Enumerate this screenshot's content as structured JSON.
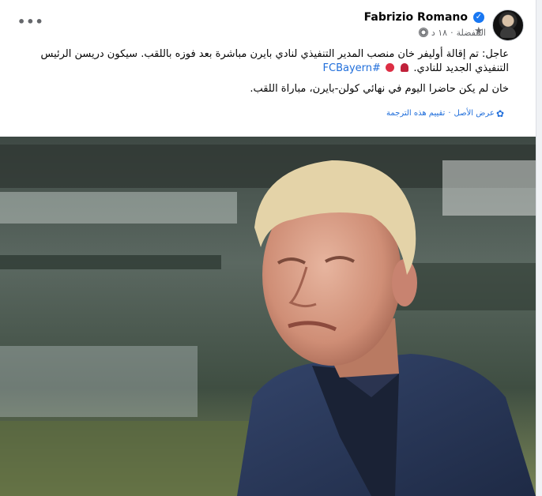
{
  "post": {
    "author": "Fabrizio Romano",
    "verified_mark": "✓",
    "favorites_label": "المفضلة",
    "time": "١٨ د",
    "separator": "·",
    "more_label": "•••",
    "paragraph1": "عاجل: تم إقالة أوليفر خان منصب المدير التنفيذي لنادي بايرن مباشرة بعد فوزه باللقب. سيكون دريسن الرئيس التنفيذي الجديد للنادي.",
    "hashtag": "#FCBayern",
    "paragraph2": "خان لم يكن حاضرا اليوم في نهائي كولن-بايرن، مباراة اللقب.",
    "see_original": "عرض الأصل",
    "translate_sep": "·",
    "rate_translation": "تقييم هذه الترجمة"
  },
  "icons": {
    "verified": "verified-badge-icon",
    "star": "star-icon",
    "globe": "globe-icon",
    "gear": "gear-icon",
    "more": "more-options-icon"
  },
  "colors": {
    "link": "#216fdb",
    "verified": "#1877f2",
    "muted": "#65676b"
  }
}
